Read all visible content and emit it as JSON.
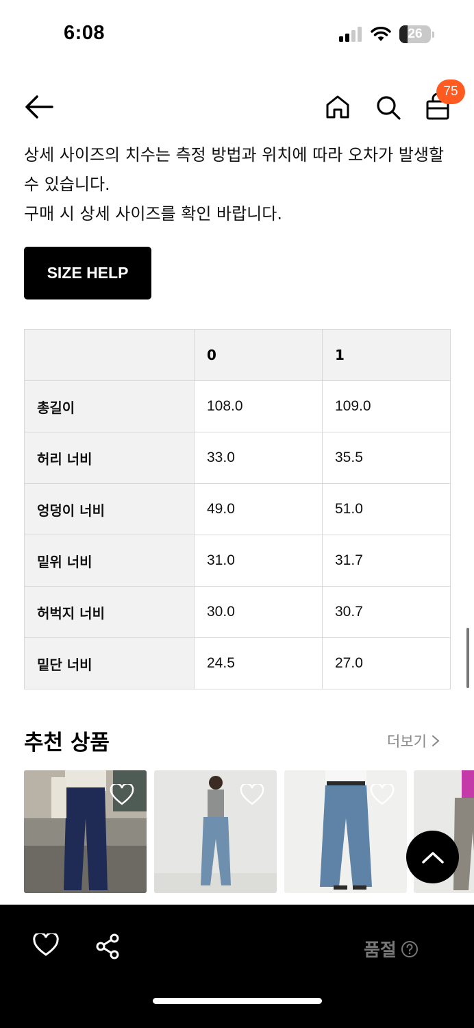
{
  "status": {
    "time": "6:08",
    "battery": "26"
  },
  "header": {
    "cart_count": "75"
  },
  "notice": {
    "line1": "상세 사이즈의 치수는 측정 방법과 위치에 따라 오차가 발생할 수 있습니다.",
    "line2": "구매 시 상세 사이즈를 확인 바랍니다."
  },
  "size_help_label": "SIZE HELP",
  "size_table": {
    "headers": [
      "",
      "0",
      "1"
    ],
    "rows": [
      {
        "label": "총길이",
        "values": [
          "108.0",
          "109.0"
        ]
      },
      {
        "label": "허리 너비",
        "values": [
          "33.0",
          "35.5"
        ]
      },
      {
        "label": "엉덩이 너비",
        "values": [
          "49.0",
          "51.0"
        ]
      },
      {
        "label": "밑위 너비",
        "values": [
          "31.0",
          "31.7"
        ]
      },
      {
        "label": "허벅지 너비",
        "values": [
          "30.0",
          "30.7"
        ]
      },
      {
        "label": "밑단 너비",
        "values": [
          "24.5",
          "27.0"
        ]
      }
    ]
  },
  "recommend": {
    "title": "추천 상품",
    "more": "더보기"
  },
  "bottom": {
    "status_label": "품절"
  },
  "colors": {
    "badge": "#ff5a1f",
    "button_bg": "#000000",
    "table_header_bg": "#f2f2f2"
  }
}
